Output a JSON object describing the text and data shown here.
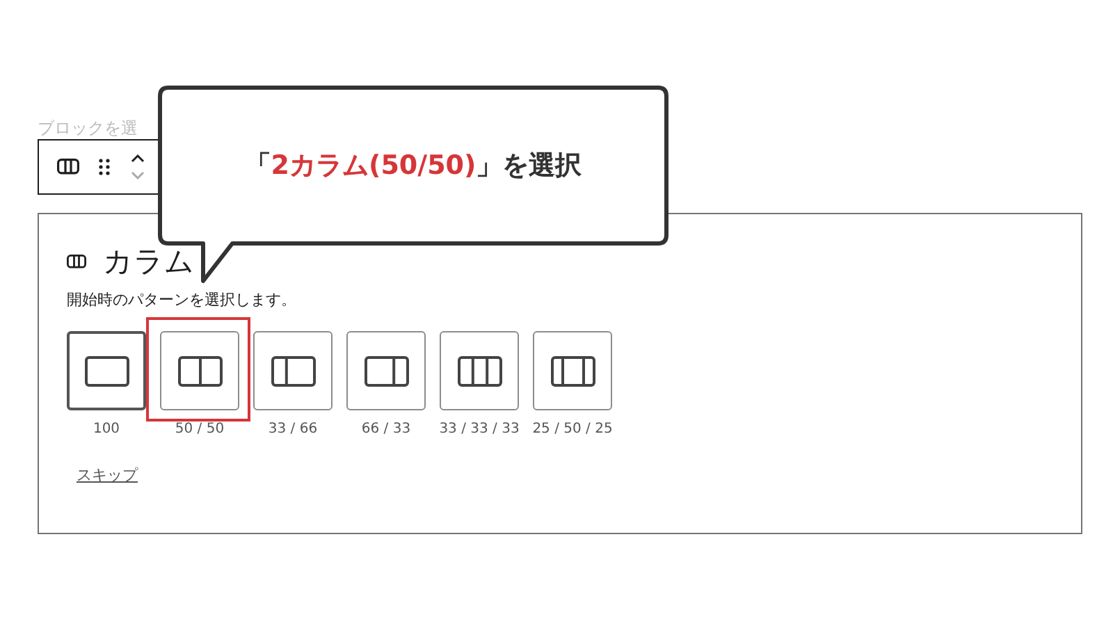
{
  "block_label": "ブロックを選",
  "panel": {
    "title": "カラム",
    "description": "開始時のパターンを選択します。",
    "patterns": [
      {
        "label": "100",
        "kind": "full",
        "selected": true,
        "highlighted": false
      },
      {
        "label": "50 / 50",
        "kind": "halves",
        "selected": false,
        "highlighted": true
      },
      {
        "label": "33 / 66",
        "kind": "thirdleft",
        "selected": false,
        "highlighted": false
      },
      {
        "label": "66 / 33",
        "kind": "thirdright",
        "selected": false,
        "highlighted": false
      },
      {
        "label": "33 / 33 / 33",
        "kind": "thirds",
        "selected": false,
        "highlighted": false
      },
      {
        "label": "25 / 50 / 25",
        "kind": "quarters",
        "selected": false,
        "highlighted": false
      }
    ],
    "skip": "スキップ"
  },
  "callout": {
    "parts": [
      {
        "text": "「",
        "kind": "plain"
      },
      {
        "text": "2カラム(50/50)",
        "kind": "accent"
      },
      {
        "text": "」を選択",
        "kind": "plain"
      }
    ]
  }
}
